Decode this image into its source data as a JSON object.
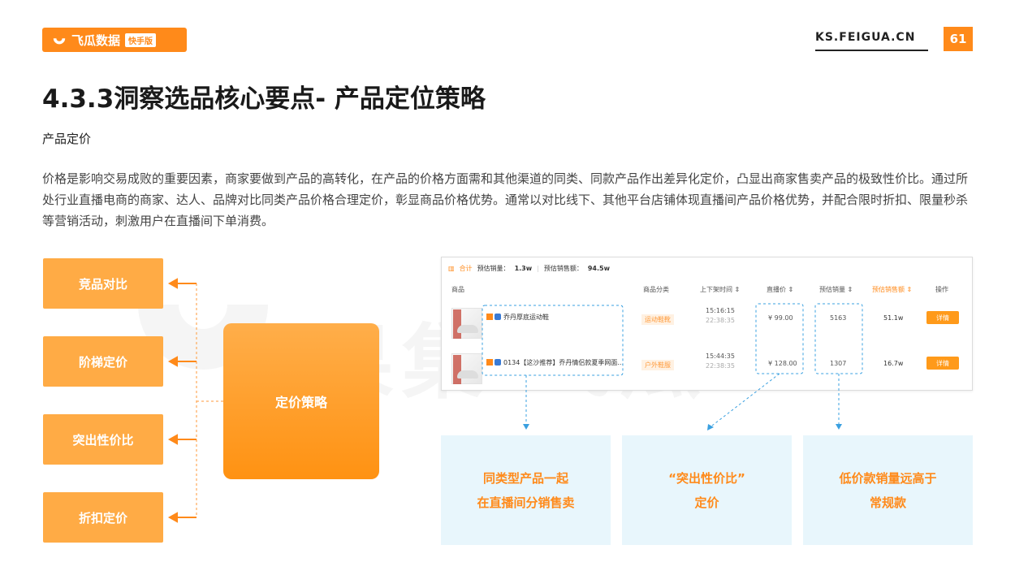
{
  "header": {
    "logo_text": "飞瓜数据",
    "logo_badge": "快手版",
    "site": "KS.FEIGUA.CN",
    "page_number": "61"
  },
  "title": "4.3.3洞察选品核心要点- 产品定位策略",
  "subtitle": "产品定价",
  "paragraph": "价格是影响交易成败的重要因素，商家要做到产品的高转化，在产品的价格方面需和其他渠道的同类、同款产品作出差异化定价，凸显出商家售卖产品的极致性价比。通过所处行业直播电商的商家、达人、品牌对比同类产品价格合理定价，彰显商品价格优势。通常以对比线下、其他平台店铺体现直播间产品价格优势，并配合限时折扣、限量秒杀等营销活动，刺激用户在直播间下单消费。",
  "watermark": {
    "text": "果集·飞瓜",
    "badge": "快手版"
  },
  "strategies": [
    "竞品对比",
    "阶梯定价",
    "突出性价比",
    "折扣定价"
  ],
  "main_strategy": "定价策略",
  "table": {
    "summary_label": "合计",
    "est_sales_label": "预估销量：",
    "est_sales_value": "1.3w",
    "est_amount_label": "预估销售额：",
    "est_amount_value": "94.5w",
    "columns": [
      "商品",
      "商品分类",
      "上下架时间 ⇕",
      "直播价 ⇕",
      "预估销量 ⇕",
      "预估销售额 ⇕",
      "操作"
    ],
    "rows": [
      {
        "name": "乔丹厚底运动鞋",
        "category": "运动鞋靴",
        "time_on": "15:16:15",
        "time_off": "22:38:35",
        "price": "¥ 99.00",
        "sales": "5163",
        "amount": "51.1w",
        "action": "详情"
      },
      {
        "name": "0134【这沙推荐】乔丹情侣款夏季网面...",
        "category": "户外鞋服",
        "time_on": "15:44:35",
        "time_off": "22:38:35",
        "price": "¥ 128.00",
        "sales": "1307",
        "amount": "16.7w",
        "action": "详情"
      }
    ]
  },
  "info_boxes": [
    {
      "line1": "同类型产品一起",
      "line2": "在直播间分销售卖"
    },
    {
      "line1": "“突出性价比”",
      "line2": "定价"
    },
    {
      "line1": "低价款销量远高于",
      "line2": "常规款"
    }
  ],
  "colors": {
    "accent": "#ff8a1a",
    "strategy_box": "#ffab45",
    "info_bg": "#e8f6fc",
    "dashed_blue": "#3aa0e0"
  }
}
